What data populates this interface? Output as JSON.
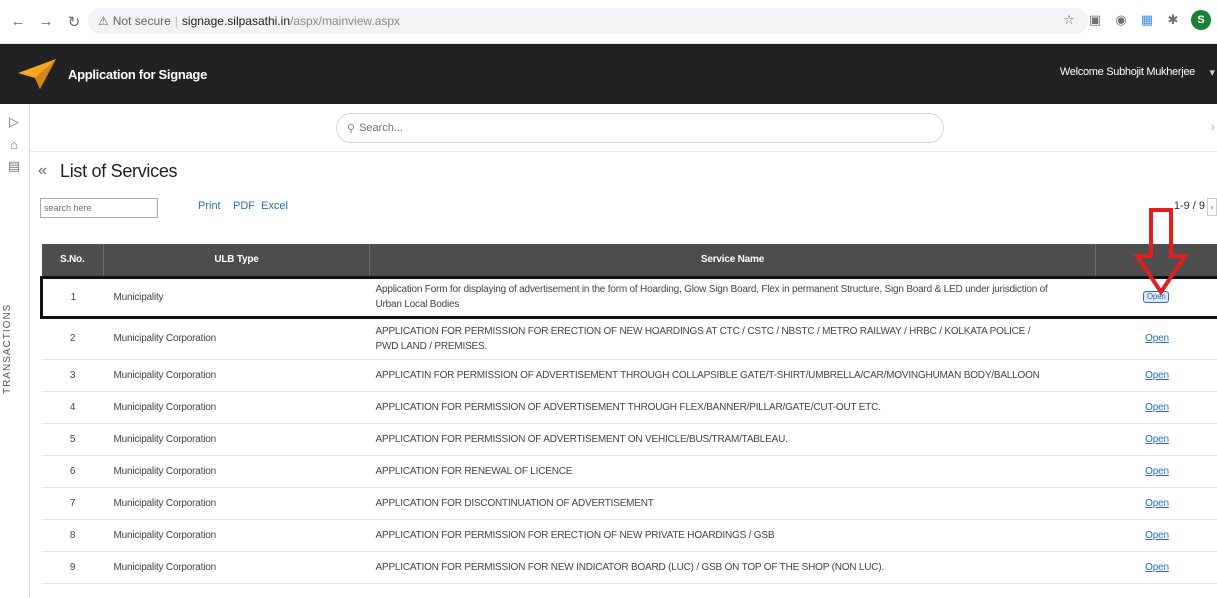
{
  "browser": {
    "security_label": "Not secure",
    "host": "signage.silpasathi.in",
    "path": "/aspx/mainview.aspx",
    "profile_initial": "S"
  },
  "header": {
    "app_title": "Application for Signage",
    "welcome": "Welcome Subhojit Mukherjee"
  },
  "search": {
    "placeholder": "Search..."
  },
  "rail": {
    "label": "TRANSACTIONS"
  },
  "page": {
    "title": "List of Services"
  },
  "tools": {
    "filter_placeholder": "search here",
    "print": "Print",
    "pdf": "PDF",
    "excel": "Excel",
    "pager": "1-9 / 9"
  },
  "table": {
    "headers": [
      "S.No.",
      "ULB Type",
      "Service Name",
      ""
    ],
    "action_label": "Open",
    "rows": [
      {
        "sno": "1",
        "ulb": "Municipality",
        "service": "Application Form for displaying of advertisement in the form of Hoarding, Glow Sign Board, Flex in permanent Structure, Sign Board & LED under jurisdiction of Urban Local Bodies"
      },
      {
        "sno": "2",
        "ulb": "Municipality Corporation",
        "service": "APPLICATION FOR PERMISSION FOR ERECTION OF NEW HOARDINGS AT CTC / CSTC / NBSTC / METRO RAILWAY / HRBC / KOLKATA POLICE / PWD LAND / PREMISES."
      },
      {
        "sno": "3",
        "ulb": "Municipality Corporation",
        "service": "APPLICATIN FOR PERMISSION OF ADVERTISEMENT THROUGH COLLAPSIBLE GATE/T-SHIRT/UMBRELLA/CAR/MOVINGHUMAN BODY/BALLOON"
      },
      {
        "sno": "4",
        "ulb": "Municipality Corporation",
        "service": "APPLICATION FOR PERMISSION OF ADVERTISEMENT THROUGH FLEX/BANNER/PILLAR/GATE/CUT-OUT ETC."
      },
      {
        "sno": "5",
        "ulb": "Municipality Corporation",
        "service": "APPLICATION FOR PERMISSION OF ADVERTISEMENT ON VEHICLE/BUS/TRAM/TABLEAU."
      },
      {
        "sno": "6",
        "ulb": "Municipality Corporation",
        "service": "APPLICATION FOR RENEWAL OF LICENCE"
      },
      {
        "sno": "7",
        "ulb": "Municipality Corporation",
        "service": "APPLICATION FOR DISCONTINUATION OF ADVERTISEMENT"
      },
      {
        "sno": "8",
        "ulb": "Municipality Corporation",
        "service": "APPLICATION FOR PERMISSION FOR ERECTION OF NEW PRIVATE HOARDINGS / GSB"
      },
      {
        "sno": "9",
        "ulb": "Municipality Corporation",
        "service": "APPLICATION FOR PERMISSION FOR NEW INDICATOR BOARD (LUC) / GSB ON TOP OF THE SHOP (NON LUC)."
      }
    ]
  },
  "colors": {
    "header_bg": "#222222",
    "table_header_bg": "#4d4d4d",
    "link": "#2a6fb6",
    "annotation": "#e02020",
    "logo": "#f5a623"
  }
}
